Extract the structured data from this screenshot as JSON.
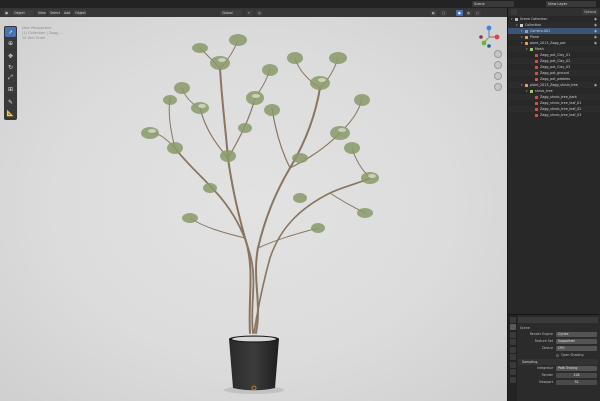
{
  "topbar": {
    "scene_label": "Scene",
    "view_layer_label": "View Layer"
  },
  "viewport": {
    "mode": "Object Mode",
    "menus": [
      "View",
      "Select",
      "Add",
      "Object"
    ],
    "orientation": "Global",
    "overlay_lines": [
      "User Perspective",
      "(1) Collection | Zagg_...",
      "10 Unit Scale"
    ],
    "axes": {
      "x": "X",
      "y": "Y",
      "z": "Z"
    }
  },
  "outliner": {
    "title": "Scene Collection",
    "filter_label": "Options",
    "rows": [
      {
        "label": "Scene Collection",
        "level": 0,
        "color": "#bdbdbd"
      },
      {
        "label": "Collection",
        "level": 1,
        "color": "#d0d0d0"
      },
      {
        "label": "Camera.001",
        "level": 2,
        "color": "#7ea3d3",
        "selected": true
      },
      {
        "label": "Plane",
        "level": 2,
        "color": "#e0a060"
      },
      {
        "label": "plant_2013_Zagg_pot",
        "level": 2,
        "color": "#e0a060"
      },
      {
        "label": "Mesh",
        "level": 3,
        "color": "#9fcf6d"
      },
      {
        "label": "Zagg_pot_Clay_01",
        "level": 4,
        "color": "#d05050"
      },
      {
        "label": "Zagg_pot_Clay_02",
        "level": 4,
        "color": "#d05050"
      },
      {
        "label": "Zagg_pot_Clay_03",
        "level": 4,
        "color": "#d05050"
      },
      {
        "label": "Zagg_pot_ground",
        "level": 4,
        "color": "#d05050"
      },
      {
        "label": "Zagg_pot_pebbles",
        "level": 4,
        "color": "#d05050"
      },
      {
        "label": "plant_2013_Zagg_shrub_tree",
        "level": 2,
        "color": "#e0a060"
      },
      {
        "label": "shrub_tree",
        "level": 3,
        "color": "#9fcf6d"
      },
      {
        "label": "Zagg_shrub_tree_bark",
        "level": 4,
        "color": "#d05050"
      },
      {
        "label": "Zagg_shrub_tree_leaf_01",
        "level": 4,
        "color": "#d05050"
      },
      {
        "label": "Zagg_shrub_tree_leaf_02",
        "level": 4,
        "color": "#d05050"
      },
      {
        "label": "Zagg_shrub_tree_leaf_03",
        "level": 4,
        "color": "#d05050"
      }
    ]
  },
  "properties": {
    "scene_name": "Scene",
    "render_engine_label": "Render Engine",
    "render_engine_value": "Cycles",
    "feature_set_label": "Feature Set",
    "feature_set_value": "Supported",
    "device_label": "Device",
    "device_value": "CPU",
    "osl_label": "Open Shading Language",
    "sampling_label": "Sampling",
    "integrator_label": "Integrator",
    "integrator_value": "Path Tracing",
    "render_label": "Render",
    "render_value": "128",
    "viewport_label": "Viewport",
    "viewport_value": "32"
  },
  "colors": {
    "accent": "#4772b3",
    "viewport_bg": "#dadada",
    "panel_bg": "#282828"
  }
}
